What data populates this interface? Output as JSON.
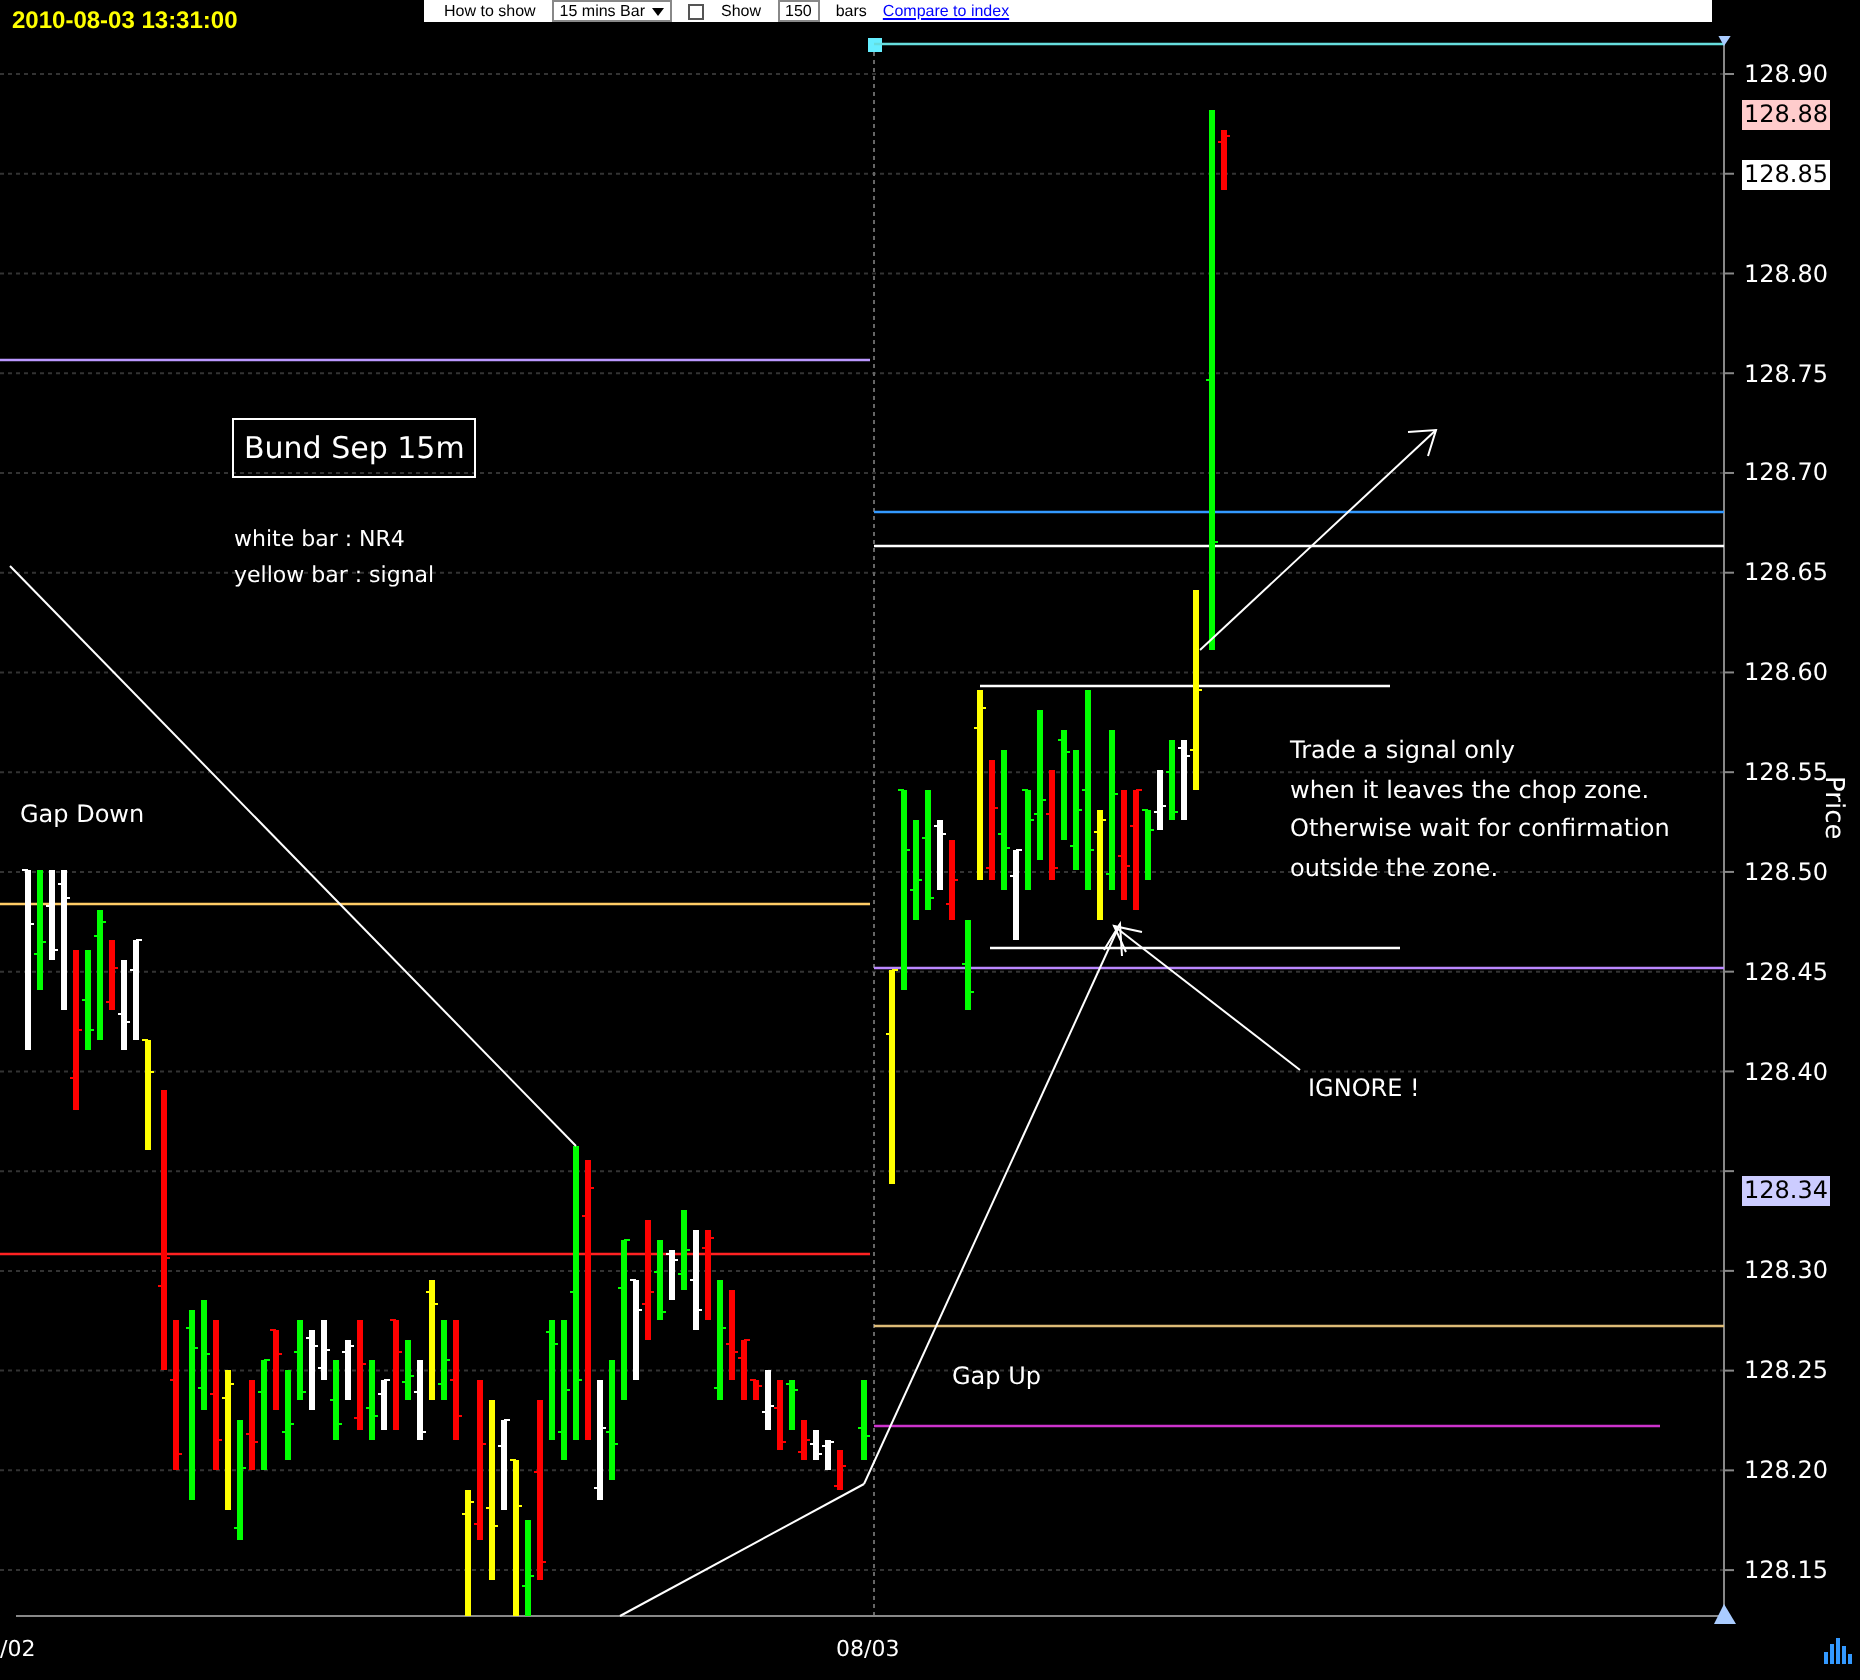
{
  "header": {
    "timestamp": "2010-08-03 13:31:00",
    "toolbar": [
      {
        "kind": "dropdown",
        "label": "How to show",
        "value": "15 mins Bar"
      },
      {
        "kind": "checkbox",
        "label": "Show",
        "checked": false,
        "value": "150",
        "suffix": "bars"
      },
      {
        "kind": "link",
        "label": "Compare to index"
      }
    ]
  },
  "chart": {
    "title": "Bund Sep 15m",
    "legend": [
      "white bar : NR4",
      "yellow bar : signal"
    ],
    "annotations": [
      {
        "kind": "label",
        "text": "Gap Down"
      },
      {
        "kind": "note",
        "text": "Trade a signal only\nwhen it leaves the chop zone.\nOtherwise wait for confirmation\noutside the zone."
      },
      {
        "kind": "label",
        "text": "IGNORE !"
      },
      {
        "kind": "label",
        "text": "Gap Up"
      }
    ],
    "y_axis": {
      "label": "Price",
      "ticks": [
        "128.90",
        "128.80",
        "128.75",
        "128.70",
        "128.65",
        "128.60",
        "128.55",
        "128.50",
        "128.45",
        "128.40",
        "128.30",
        "128.25",
        "128.20",
        "128.15"
      ]
    },
    "price_tags": [
      {
        "text": "128.88",
        "color": "#ffcccc"
      },
      {
        "text": "128.85",
        "color": "#ffffff"
      },
      {
        "text": "128.34",
        "color": "#ccccff"
      }
    ],
    "x_axis": {
      "labels": [
        "/02",
        "08/03"
      ]
    }
  }
}
